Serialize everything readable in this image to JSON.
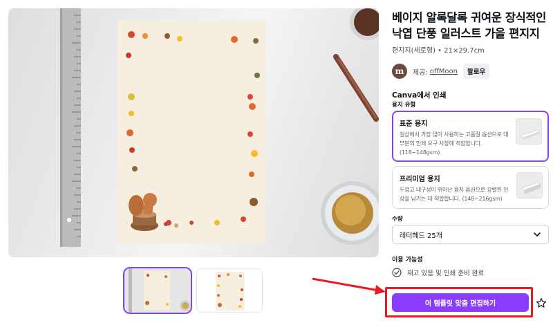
{
  "product": {
    "title": "베이지 알록달록 귀여운 장식적인 낙엽 단풍 일러스트 가을 편지지",
    "meta": "편지지(세로형) • 21×29.7cm"
  },
  "creator": {
    "avatar_letter": "m",
    "by_label": "제공:",
    "name": "offMoon",
    "follow_label": "팔로우"
  },
  "print": {
    "heading": "Canva에서 인쇄",
    "paper_type_label": "용지 유형",
    "options": [
      {
        "name": "표준 용지",
        "desc": "일상에서 가장 많이 사용하는 고품질 옵션으로 대부분의 인쇄 요구 사항에 적합합니다. (118~148gsm)",
        "selected": true
      },
      {
        "name": "프리미엄 용지",
        "desc": "두껍고 내구성이 뛰어난 용지 옵션으로 강렬한 인상을 남기는 데 적합합니다. (148~216gsm)",
        "selected": false
      }
    ]
  },
  "quantity": {
    "label": "수량",
    "value": "레터헤드 25개"
  },
  "availability": {
    "label": "이용 가능성",
    "status": "재고 있음 및 인쇄 준비 완료"
  },
  "cta": {
    "label": "이 템플릿 맞춤 편집하기"
  },
  "icons": {
    "favorite": "star-icon",
    "quantity_dropdown": "chevron-down-icon",
    "availability": "check-circle-icon"
  },
  "colors": {
    "accent": "#8b3dff",
    "highlight": "#e51c23",
    "paper": "#f6eedf"
  }
}
